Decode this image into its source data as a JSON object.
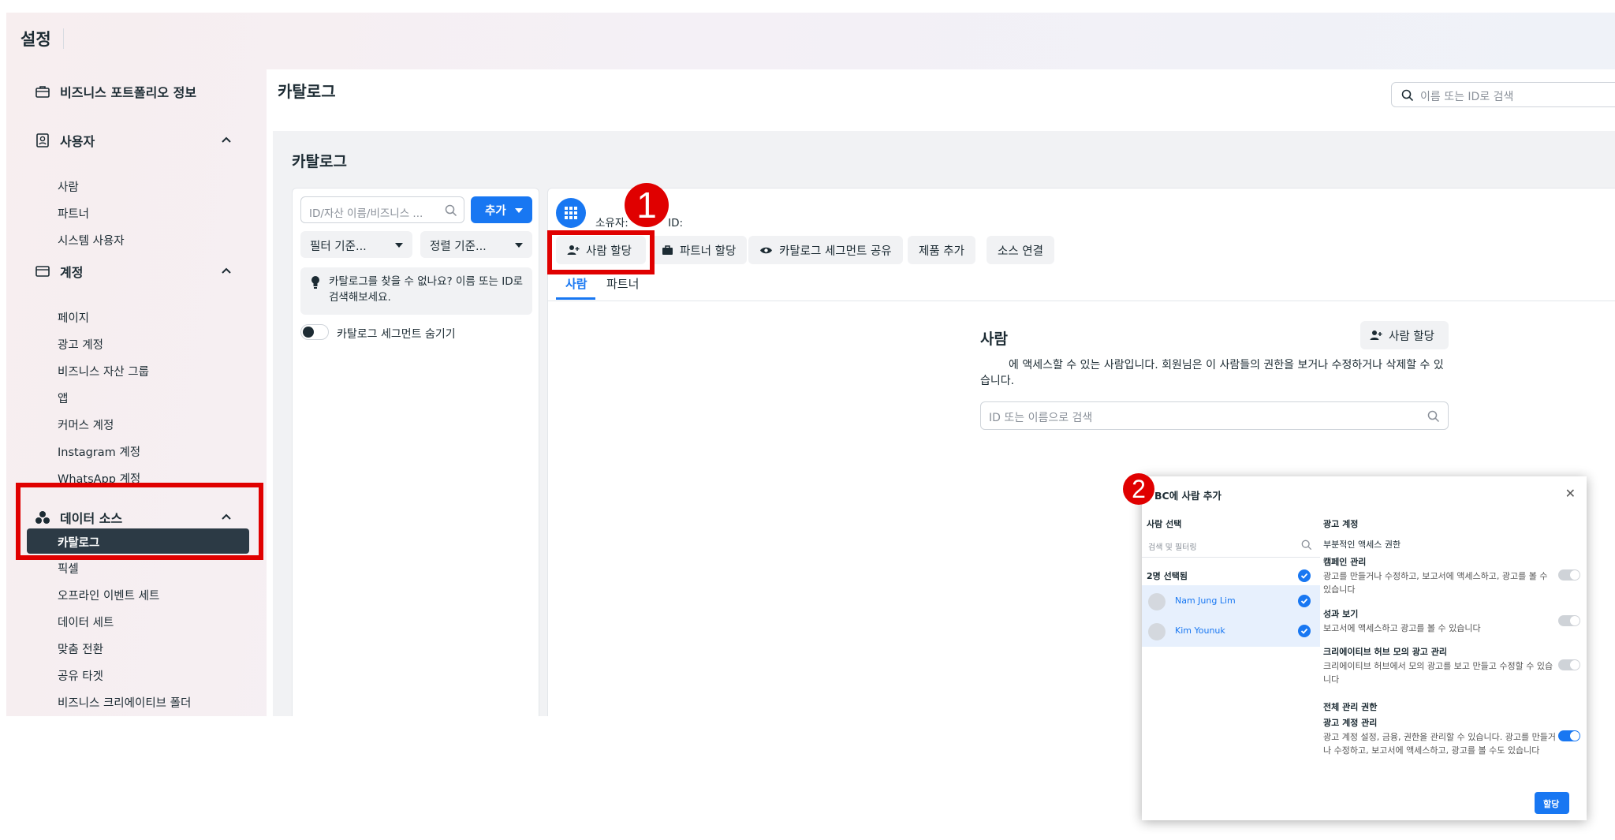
{
  "app": {
    "title": "설정"
  },
  "sidebar": {
    "portfolio": "비즈니스 포트폴리오 정보",
    "users": {
      "label": "사용자",
      "items": [
        "사람",
        "파트너",
        "시스템 사용자"
      ]
    },
    "accounts": {
      "label": "계정",
      "items": [
        "페이지",
        "광고 계정",
        "비즈니스 자산 그룹",
        "앱",
        "커머스 계정",
        "Instagram 계정",
        "WhatsApp 계정"
      ]
    },
    "datasources": {
      "label": "데이터 소스",
      "active": "카탈로그",
      "items": [
        "픽셀",
        "오프라인 이벤트 세트",
        "데이터 세트",
        "맞춤 전환",
        "공유 타겟",
        "비즈니스 크리에이티브 폴더"
      ]
    }
  },
  "header": {
    "title": "카탈로그",
    "search_placeholder": "이름 또는 ID로 검색"
  },
  "content": {
    "title": "카탈로그"
  },
  "left_panel": {
    "search_placeholder": "ID/자산 이름/비즈니스 ...",
    "add_label": "추가",
    "filter_label": "필터 기준...",
    "sort_label": "정렬 기준...",
    "tip": "카탈로그를 찾을 수 없나요? 이름 또는 ID로 검색해보세요.",
    "toggle_label": "카탈로그 세그먼트 숨기기"
  },
  "right_panel": {
    "owner_label": "소유자:",
    "id_label": "ID:",
    "actions": [
      "사람 할당",
      "파트너 할당",
      "카탈로그 세그먼트 공유",
      "제품 추가",
      "소스 연결"
    ],
    "tabs": [
      "사람",
      "파트너"
    ],
    "people": {
      "title": "사람",
      "assign_label": "사람 할당",
      "description": "에 액세스할 수 있는 사람입니다. 회원님은 이 사람들의 권한을 보거나 수정하거나 삭제할 수 있습니다.",
      "search_placeholder": "ID 또는 이름으로 검색"
    }
  },
  "badges": {
    "one": "1",
    "two": "2"
  },
  "dialog": {
    "title": "BC에 사람 추가",
    "select_people": "사람 선택",
    "search_placeholder": "검색 및 필터링",
    "selected_count": "2명 선택됨",
    "users": [
      "Nam Jung Lim",
      "Kim Younuk"
    ],
    "section": "광고 계정",
    "partial": "부분적인 액세스 권한",
    "perms": [
      {
        "title": "캠페인 관리",
        "desc": "광고를 만들거나 수정하고, 보고서에 액세스하고, 광고를 볼 수 있습니다",
        "on": false
      },
      {
        "title": "성과 보기",
        "desc": "보고서에 액세스하고 광고를 볼 수 있습니다",
        "on": false
      },
      {
        "title": "크리에이티브 허브 모의 광고 관리",
        "desc": "크리에이티브 허브에서 모의 광고를 보고 만들고 수정할 수 있습니다",
        "on": false
      }
    ],
    "full": "전체 관리 권한",
    "full_perm": {
      "title": "광고 계정 관리",
      "desc": "광고 계정 설정, 금융, 권한을 관리할 수 있습니다. 광고를 만들거나 수정하고, 보고서에 액세스하고, 광고를 볼 수도 있습니다",
      "on": true
    },
    "assign": "할당"
  },
  "colors": {
    "accent": "#1877f2",
    "highlight": "#e00000",
    "active_nav": "#2c3a45"
  }
}
